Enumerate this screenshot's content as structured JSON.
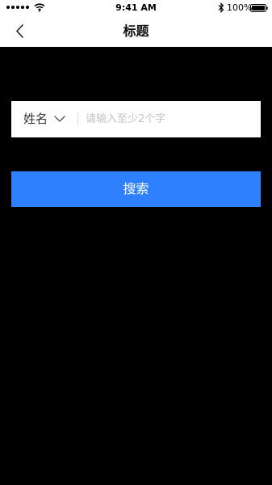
{
  "status_bar": {
    "time": "9:41 AM",
    "battery": "100%",
    "icons": [
      "signal-icon",
      "wifi-icon",
      "bluetooth-icon",
      "battery-icon"
    ]
  },
  "nav": {
    "title": "标题",
    "back_icon": "chevron-left-icon"
  },
  "search": {
    "field_label": "姓名",
    "placeholder": "请输入至少2个字",
    "value": "",
    "dropdown_icon": "chevron-down-icon"
  },
  "actions": {
    "search_label": "搜索"
  },
  "colors": {
    "primary": "#2f80ff",
    "background": "#000000",
    "surface": "#ffffff"
  }
}
